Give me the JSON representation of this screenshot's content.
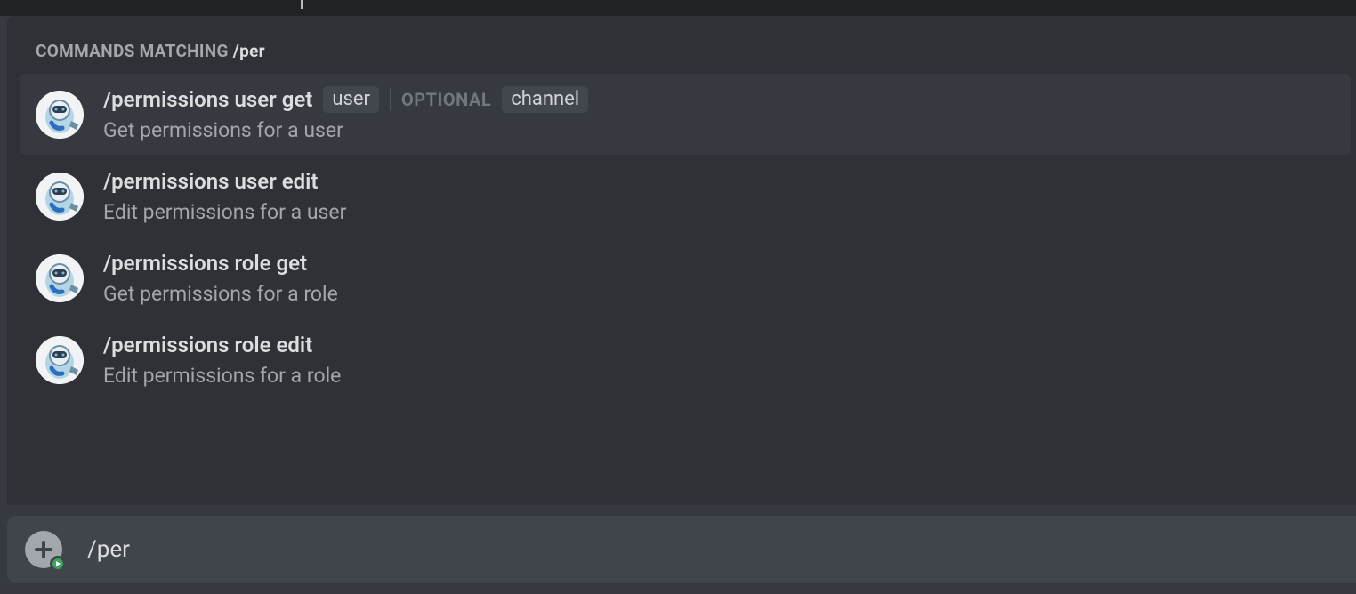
{
  "header": {
    "prefix": "Commands matching ",
    "query": "/per"
  },
  "commands": [
    {
      "name": "/permissions user get",
      "description": "Get permissions for a user",
      "args": [
        {
          "label": "user"
        }
      ],
      "optional_label": "OPTIONAL",
      "optional_args": [
        {
          "label": "channel"
        }
      ],
      "active": true
    },
    {
      "name": "/permissions user edit",
      "description": "Edit permissions for a user",
      "args": [],
      "optional_args": [],
      "active": false
    },
    {
      "name": "/permissions role get",
      "description": "Get permissions for a role",
      "args": [],
      "optional_args": [],
      "active": false
    },
    {
      "name": "/permissions role edit",
      "description": "Edit permissions for a role",
      "args": [],
      "optional_args": [],
      "active": false
    }
  ],
  "input": {
    "value": "/per"
  }
}
